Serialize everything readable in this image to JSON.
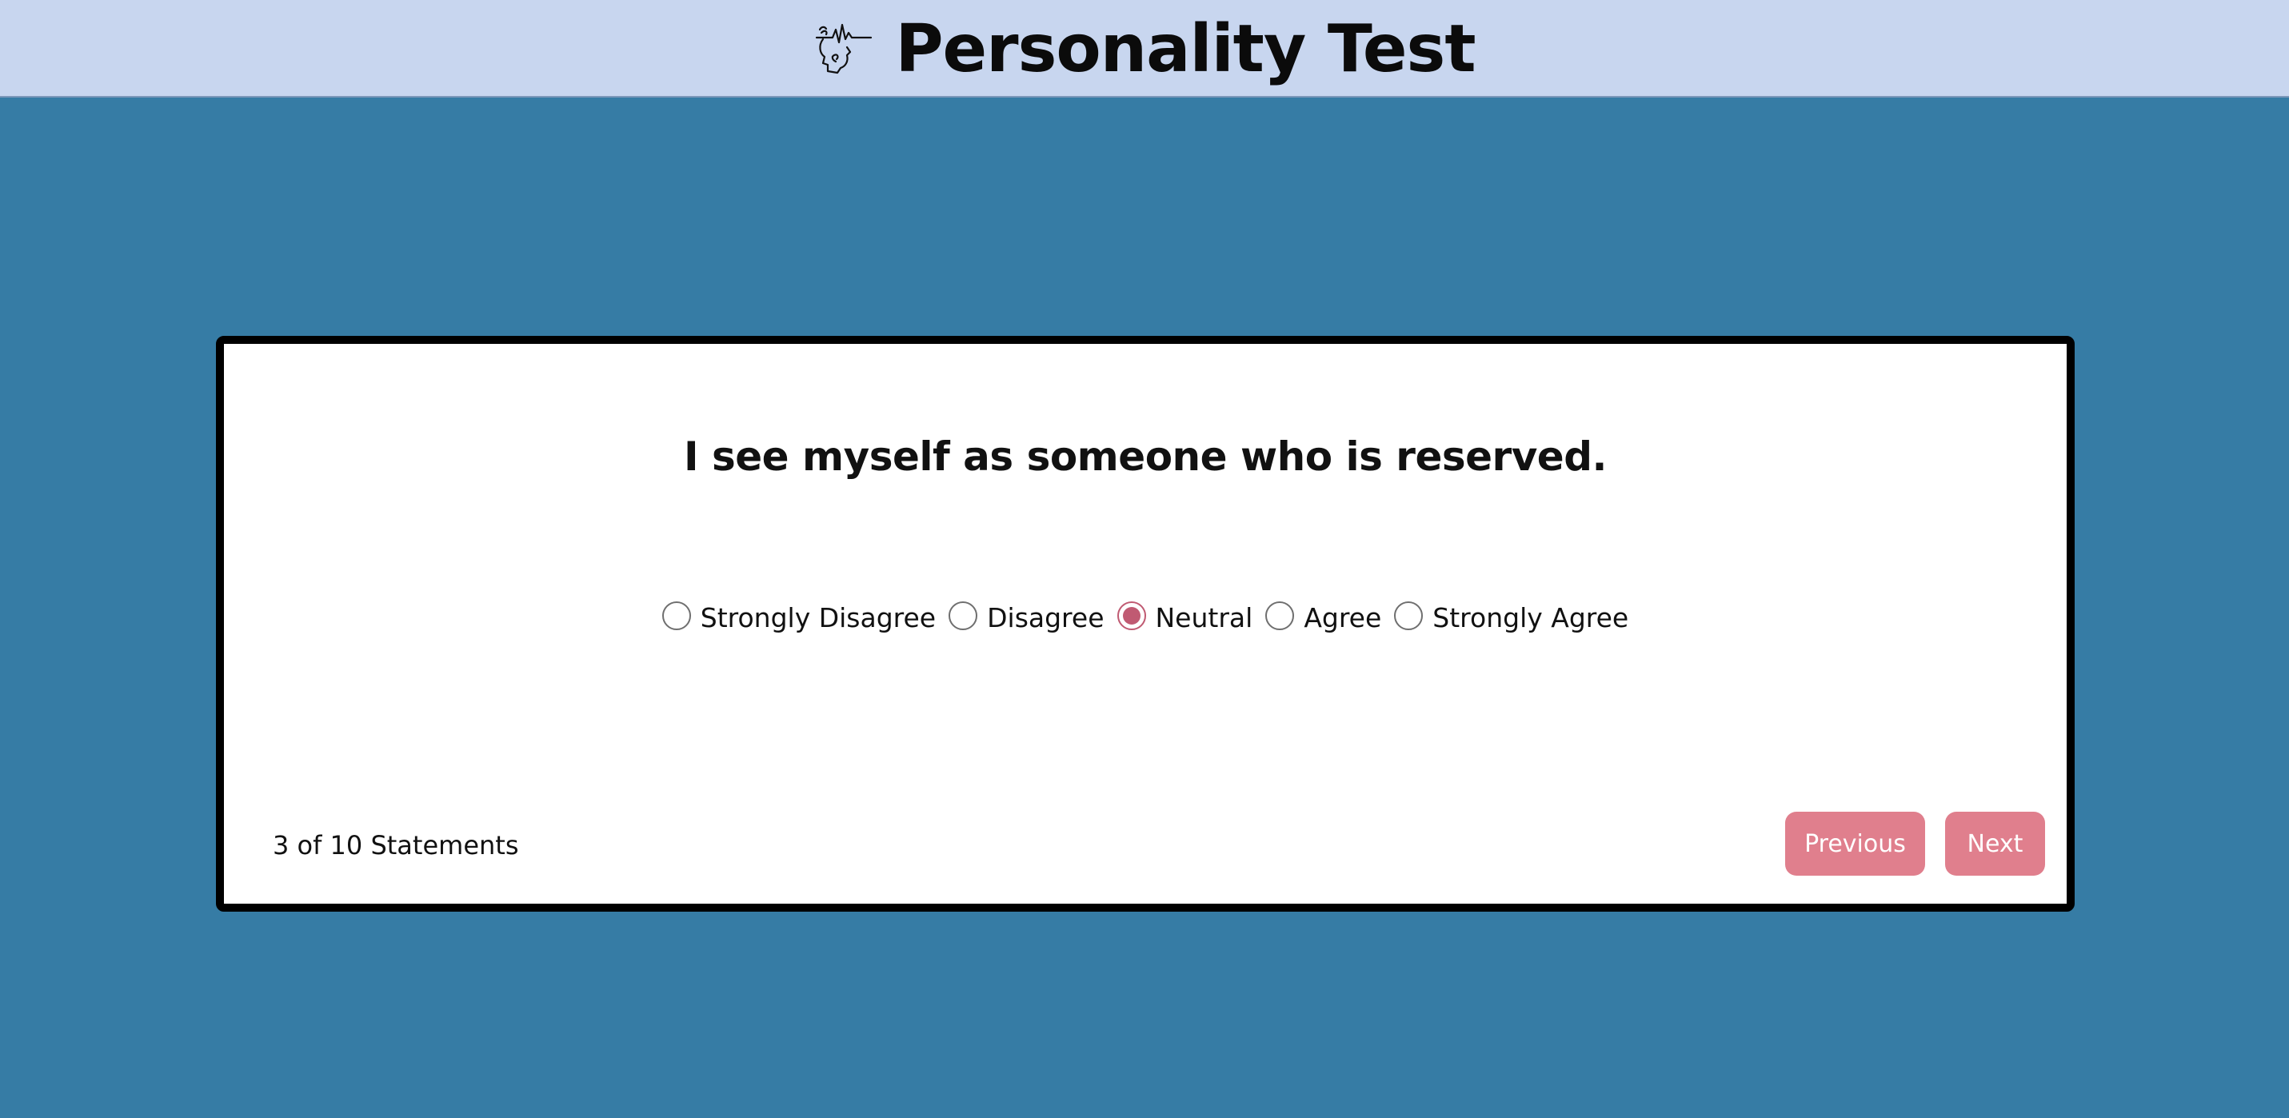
{
  "header": {
    "title": "Personality Test",
    "logo_icon": "head-brainwave-icon"
  },
  "question": {
    "text": "I see myself as someone who is reserved."
  },
  "options": [
    {
      "label": "Strongly Disagree",
      "selected": false
    },
    {
      "label": "Disagree",
      "selected": false
    },
    {
      "label": "Neutral",
      "selected": true
    },
    {
      "label": "Agree",
      "selected": false
    },
    {
      "label": "Strongly Agree",
      "selected": false
    }
  ],
  "progress": {
    "label": "3 of 10 Statements",
    "current": 3,
    "total": 10
  },
  "nav": {
    "previous_label": "Previous",
    "next_label": "Next"
  },
  "colors": {
    "header_bg": "#c8d6ef",
    "page_bg": "#367ca5",
    "button_bg": "#e07f8d",
    "radio_accent": "#c05a72"
  }
}
